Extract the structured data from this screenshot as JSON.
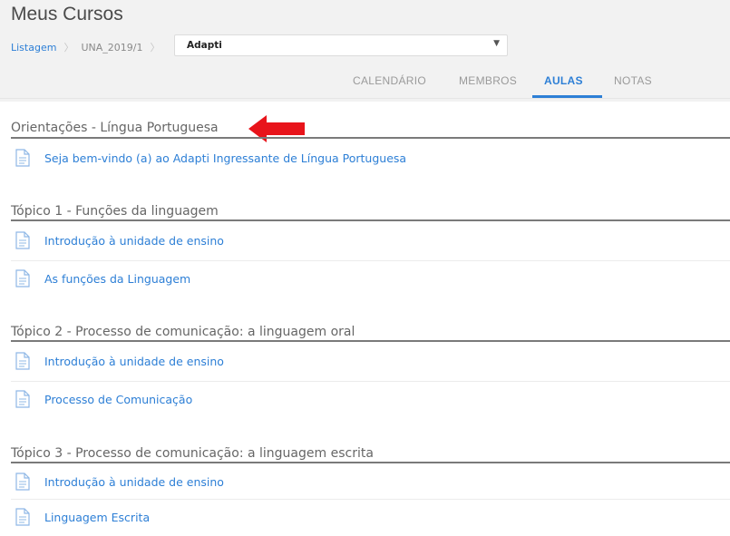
{
  "header": {
    "title": "Meus Cursos",
    "breadcrumb": {
      "link": "Listagem",
      "separator": "〉",
      "middle": "UNA_2019/1",
      "separator2": "〉"
    },
    "course_select": {
      "selected": "Adapti",
      "arrow": "▼"
    }
  },
  "tabs": [
    {
      "label": "CALENDÁRIO",
      "active": false
    },
    {
      "label": "MEMBROS",
      "active": false
    },
    {
      "label": "AULAS",
      "active": true
    },
    {
      "label": "NOTAS",
      "active": false
    }
  ],
  "sections": [
    {
      "title": "Orientações - Língua Portuguesa",
      "lessons": [
        {
          "label": "Seja bem-vindo (a) ao Adapti Ingressante de Língua Portuguesa"
        }
      ]
    },
    {
      "title": "Tópico 1 - Funções da linguagem",
      "lessons": [
        {
          "label": "Introdução à unidade de ensino"
        },
        {
          "label": "As funções da Linguagem"
        }
      ]
    },
    {
      "title": "Tópico 2 - Processo de comunicação: a linguagem oral",
      "lessons": [
        {
          "label": "Introdução à unidade de ensino"
        },
        {
          "label": "Processo de Comunicação"
        }
      ]
    },
    {
      "title": "Tópico 3 - Processo de comunicação: a linguagem escrita",
      "lessons": [
        {
          "label": "Introdução à unidade de ensino"
        },
        {
          "label": "Linguagem Escrita"
        }
      ]
    }
  ],
  "colors": {
    "accent": "#2d7fd6",
    "arrow": "#e8141b"
  },
  "icons": {
    "lesson": "document-icon",
    "annotation": "red-arrow-icon"
  }
}
